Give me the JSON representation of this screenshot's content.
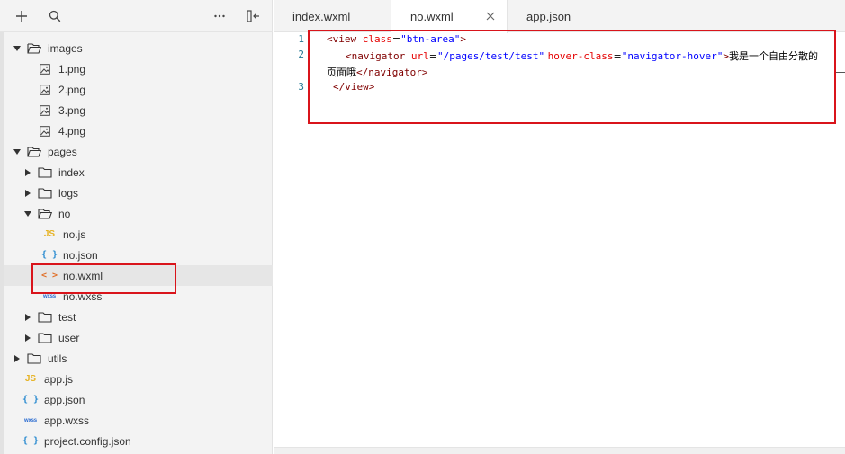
{
  "toolbar": {
    "icons": [
      "add-icon",
      "search-icon",
      "more-icon",
      "collapse-sidebar-icon"
    ]
  },
  "tree": [
    {
      "label": "images",
      "depth": 0,
      "type": "folder",
      "state": "open"
    },
    {
      "label": "1.png",
      "depth": 1,
      "type": "image"
    },
    {
      "label": "2.png",
      "depth": 1,
      "type": "image"
    },
    {
      "label": "3.png",
      "depth": 1,
      "type": "image"
    },
    {
      "label": "4.png",
      "depth": 1,
      "type": "image"
    },
    {
      "label": "pages",
      "depth": 0,
      "type": "folder",
      "state": "open"
    },
    {
      "label": "index",
      "depth": 1,
      "type": "folder",
      "state": "closed"
    },
    {
      "label": "logs",
      "depth": 1,
      "type": "folder",
      "state": "closed"
    },
    {
      "label": "no",
      "depth": 1,
      "type": "folder",
      "state": "open"
    },
    {
      "label": "no.js",
      "depth": 2,
      "type": "js"
    },
    {
      "label": "no.json",
      "depth": 2,
      "type": "json"
    },
    {
      "label": "no.wxml",
      "depth": 2,
      "type": "wxml",
      "selected": true
    },
    {
      "label": "no.wxss",
      "depth": 2,
      "type": "wxss"
    },
    {
      "label": "test",
      "depth": 1,
      "type": "folder",
      "state": "closed"
    },
    {
      "label": "user",
      "depth": 1,
      "type": "folder",
      "state": "closed"
    },
    {
      "label": "utils",
      "depth": 0,
      "type": "folder",
      "state": "closed"
    },
    {
      "label": "app.js",
      "depth": 0,
      "type": "js"
    },
    {
      "label": "app.json",
      "depth": 0,
      "type": "json"
    },
    {
      "label": "app.wxss",
      "depth": 0,
      "type": "wxss"
    },
    {
      "label": "project.config.json",
      "depth": 0,
      "type": "json"
    }
  ],
  "icon_glyphs": {
    "js": "JS",
    "json": "{ }",
    "wxml": "< >",
    "wxss": "wxss"
  },
  "tabs": [
    {
      "label": "index.wxml",
      "active": false
    },
    {
      "label": "no.wxml",
      "active": true
    },
    {
      "label": "app.json",
      "active": false
    }
  ],
  "editor": {
    "line_numbers": [
      "1",
      "2",
      "",
      "3"
    ],
    "lines": [
      [
        {
          "t": "<view ",
          "c": "tag"
        },
        {
          "t": "class",
          "c": "attr"
        },
        {
          "t": "=",
          "c": "txt"
        },
        {
          "t": "\"btn-area\"",
          "c": "val"
        },
        {
          "t": ">",
          "c": "tag"
        }
      ],
      [
        {
          "t": "<navigator ",
          "c": "tag"
        },
        {
          "t": "url",
          "c": "attr"
        },
        {
          "t": "=",
          "c": "txt"
        },
        {
          "t": "\"/pages/test/test\"",
          "c": "val"
        },
        {
          "t": " ",
          "c": "txt"
        },
        {
          "t": "hover-class",
          "c": "attr"
        },
        {
          "t": "=",
          "c": "txt"
        },
        {
          "t": "\"navigator-hover\"",
          "c": "val"
        },
        {
          "t": ">",
          "c": "tag"
        },
        {
          "t": "我是一个自由分散的",
          "c": "txt"
        }
      ],
      [
        {
          "t": "页面哦",
          "c": "txt"
        },
        {
          "t": "</navigator>",
          "c": "tag"
        }
      ],
      [
        {
          "t": "</view>",
          "c": "tag"
        }
      ]
    ]
  },
  "colors": {
    "highlight": "#d9141b",
    "tag": "#800000",
    "attr": "#e50000",
    "value": "#0000ff",
    "line_number": "#237893",
    "folder_icon": "#333333",
    "js_icon": "#e6b325",
    "json_icon": "#2a8bd0",
    "wxml_icon": "#e0702a",
    "wxss_icon": "#2a6bd0"
  }
}
